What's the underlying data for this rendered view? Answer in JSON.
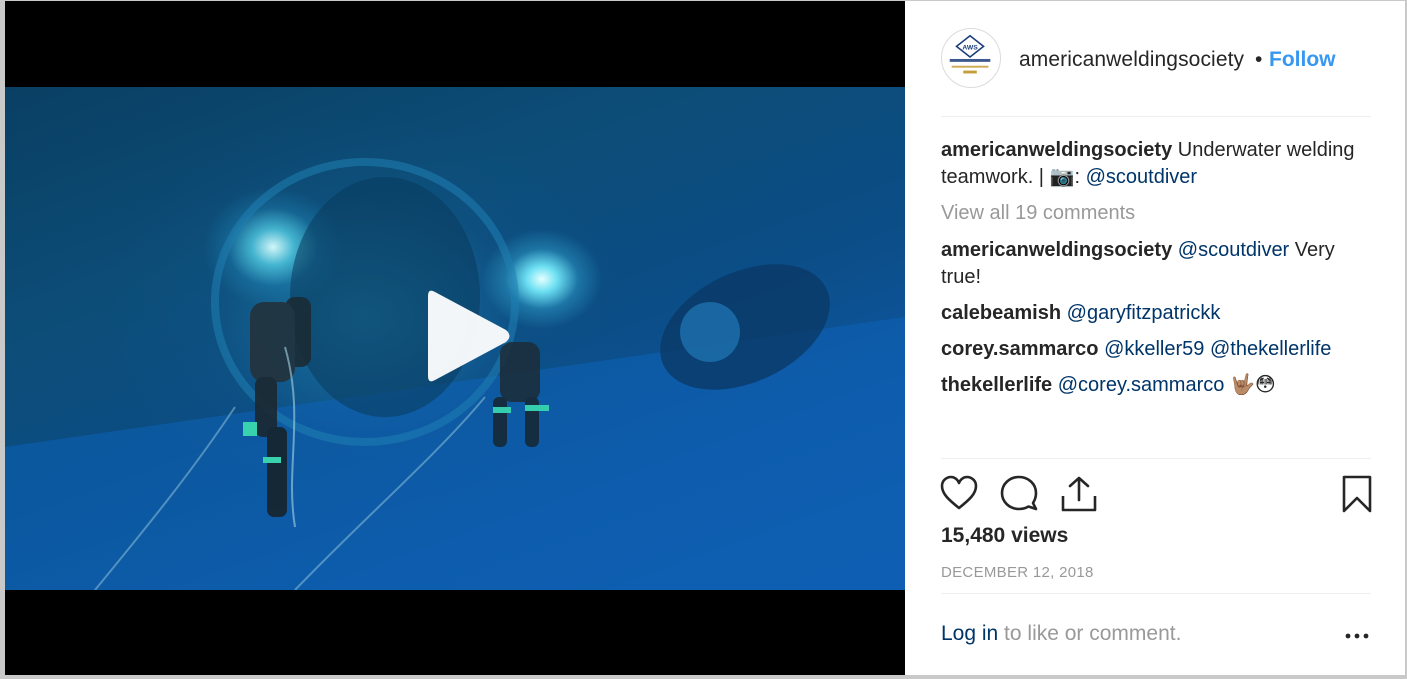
{
  "post": {
    "username": "americanweldingsociety",
    "separator": "•",
    "follow_label": "Follow",
    "avatar": {
      "logo_text": "AWS",
      "org_text": "American Welding Society",
      "tagline_text": "CELEBRATING 100 YEARS"
    }
  },
  "caption": {
    "username": "americanweldingsociety",
    "text": " Underwater welding teamwork. | ",
    "emoji": "📷",
    "colon": ": ",
    "mention": "@scoutdiver"
  },
  "view_all_label": "View all 19 comments",
  "comments": [
    {
      "username": "americanweldingsociety",
      "mention": "@scoutdiver",
      "text": " Very true!",
      "extra_mention": "",
      "emoji": ""
    },
    {
      "username": "calebeamish",
      "mention": "@garyfitzpatrickk",
      "text": "",
      "extra_mention": "",
      "emoji": ""
    },
    {
      "username": "corey.sammarco",
      "mention": "@kkeller59",
      "text": " ",
      "extra_mention": "@thekellerlife",
      "emoji": ""
    },
    {
      "username": "thekellerlife",
      "mention": "@corey.sammarco",
      "text": " ",
      "extra_mention": "",
      "emoji": "🤟🏽😳"
    }
  ],
  "actions": {
    "like": "heart-icon",
    "comment": "comment-icon",
    "share": "share-icon",
    "save": "bookmark-icon"
  },
  "views_label": "15,480 views",
  "date_label": "DECEMBER 12, 2018",
  "login": {
    "link_label": "Log in",
    "rest_label": " to like or comment."
  },
  "colors": {
    "link_blue": "#3897f0",
    "mention_navy": "#003569",
    "muted_grey": "#999999",
    "text_dark": "#262626"
  }
}
